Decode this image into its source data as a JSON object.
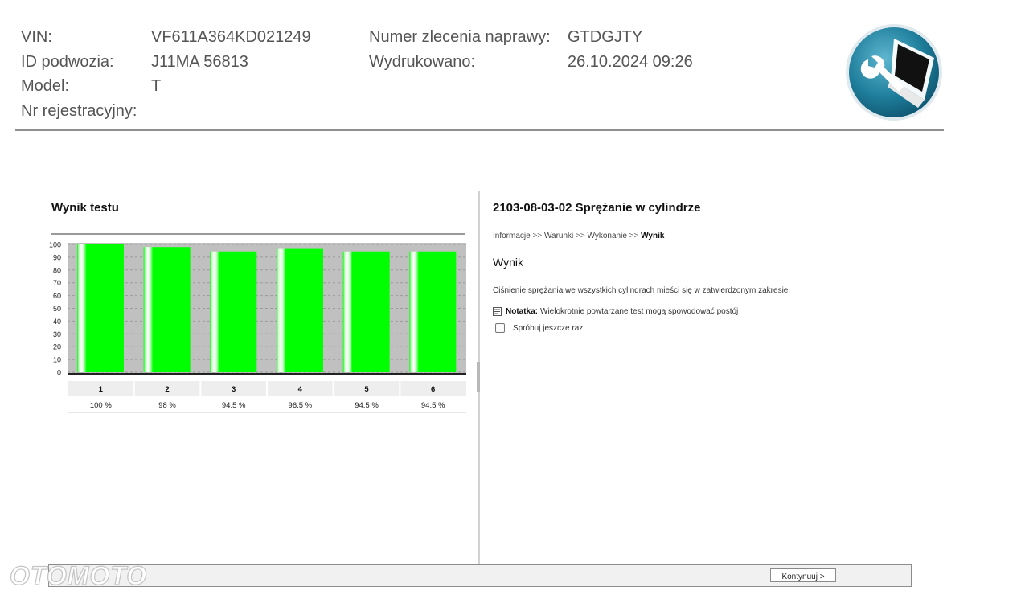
{
  "header": {
    "fields": [
      {
        "label": "VIN:",
        "value": "VF611A364KD021249"
      },
      {
        "label": "ID podwozia:",
        "value": "J11MA 56813"
      },
      {
        "label": "Model:",
        "value": "T"
      },
      {
        "label": "Nr rejestracyjny:",
        "value": ""
      },
      {
        "label": "Numer zlecenia naprawy:",
        "value": "GTDGJTY"
      },
      {
        "label": "Wydrukowano:",
        "value": "26.10.2024 09:26"
      }
    ],
    "logo_icon": "wrench-laptop-logo-icon"
  },
  "left_panel": {
    "title": "Wynik testu"
  },
  "chart_data": {
    "type": "bar",
    "categories": [
      "1",
      "2",
      "3",
      "4",
      "5",
      "6"
    ],
    "values": [
      100,
      98,
      94.5,
      96.5,
      94.5,
      94.5
    ],
    "value_labels": [
      "100 %",
      "98 %",
      "94.5 %",
      "96.5 %",
      "94.5 %",
      "94.5 %"
    ],
    "yticks": [
      "0",
      "10",
      "20",
      "30",
      "40",
      "50",
      "60",
      "70",
      "80",
      "90",
      "100"
    ],
    "ylim": [
      0,
      100
    ],
    "grid": true,
    "bar_color": "#00ff00",
    "background_color": "#c0c0c0"
  },
  "right_panel": {
    "title": "2103-08-03-02 Sprężanie w cylindrze",
    "breadcrumb": {
      "items": [
        "Informacje",
        "Warunki",
        "Wykonanie",
        "Wynik"
      ],
      "separator": ">>"
    },
    "section_title": "Wynik",
    "result_text": "Ciśnienie sprężania we wszystkich cylindrach mieści się w zatwierdzonym zakresie",
    "note": {
      "icon": "note-icon",
      "label": "Notatka:",
      "text": "Wielokrotnie powtarzane test mogą spowodować postój"
    },
    "retry_label": "Spróbuj jeszcze raz"
  },
  "footer": {
    "continue_label": "Kontynuuj >"
  },
  "watermark": "OTOMOTO"
}
